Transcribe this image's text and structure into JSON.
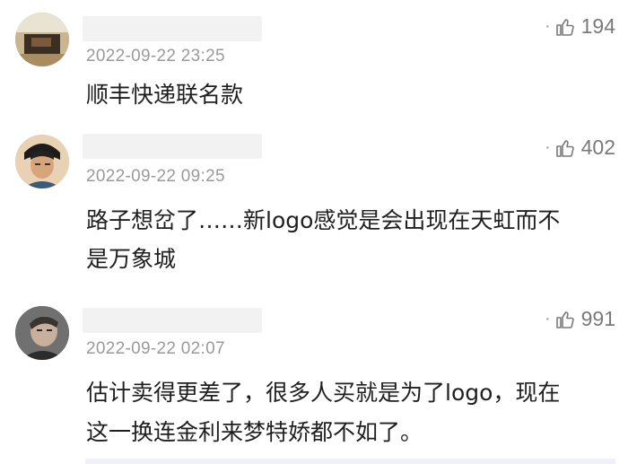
{
  "comments": [
    {
      "timestamp": "2022-09-22 23:25",
      "likes": "194",
      "text": "顺丰快递联名款"
    },
    {
      "timestamp": "2022-09-22 09:25",
      "likes": "402",
      "text_line1": "路子想岔了……新logo感觉是会出现在天虹而不",
      "text_line2": "是万象城"
    },
    {
      "timestamp": "2022-09-22 02:07",
      "likes": "991",
      "text_line1": "估计卖得更差了，很多人买就是为了logo，现在",
      "text_line2": "这一换连金利来梦特娇都不如了。"
    }
  ],
  "icons": {
    "like": "thumbs-up-icon",
    "avatar": "user-avatar-icon"
  },
  "colors": {
    "timestamp": "#9a9a9a",
    "likes": "#7a7a7a",
    "text": "#1f1f1f",
    "name_mask": "#f2f2f2"
  }
}
